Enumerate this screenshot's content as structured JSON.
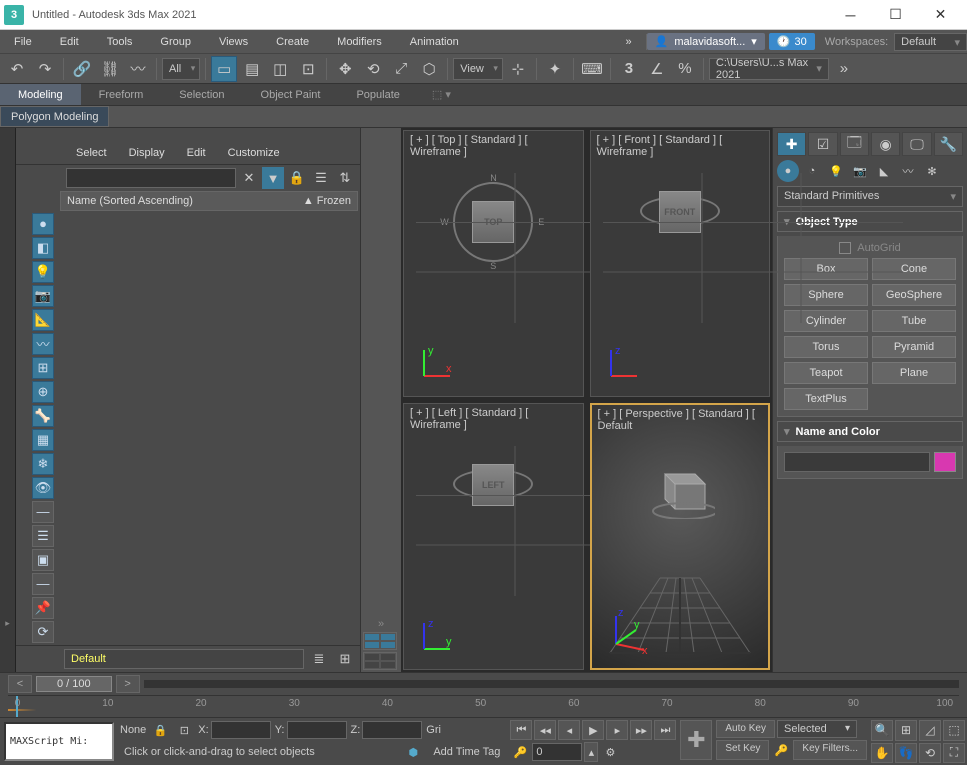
{
  "titlebar": {
    "title": "Untitled - Autodesk 3ds Max 2021"
  },
  "menubar": {
    "items": [
      "File",
      "Edit",
      "Tools",
      "Group",
      "Views",
      "Create",
      "Modifiers",
      "Animation"
    ],
    "user": "malavidasoft...",
    "clock": "30",
    "workspaces_label": "Workspaces:",
    "workspace": "Default"
  },
  "toolbar": {
    "selection_set": "All",
    "view_label": "View",
    "path": "C:\\Users\\U...s Max 2021"
  },
  "ribbon": {
    "tabs": [
      "Modeling",
      "Freeform",
      "Selection",
      "Object Paint",
      "Populate"
    ],
    "subtab": "Polygon Modeling"
  },
  "explorer": {
    "menus": [
      "Select",
      "Display",
      "Edit",
      "Customize"
    ],
    "header_name": "Name (Sorted Ascending)",
    "header_frozen": "▲ Frozen",
    "layer": "Default"
  },
  "viewports": {
    "v0": "[ + ] [ Top ] [ Standard ] [ Wireframe ]",
    "v1": "[ + ] [ Front ] [ Standard ] [ Wireframe ]",
    "v2": "[ + ] [ Left ] [ Standard ] [ Wireframe ]",
    "v3": "[ + ] [ Perspective ] [ Standard ] [ Default",
    "cube0": "TOP",
    "cube1": "FRONT",
    "cube2": "LEFT",
    "compass": {
      "n": "N",
      "s": "S",
      "e": "E",
      "w": "W"
    }
  },
  "cmdpanel": {
    "category": "Standard Primitives",
    "rollout_objtype": "Object Type",
    "autogrid": "AutoGrid",
    "buttons": [
      "Box",
      "Cone",
      "Sphere",
      "GeoSphere",
      "Cylinder",
      "Tube",
      "Torus",
      "Pyramid",
      "Teapot",
      "Plane",
      "TextPlus"
    ],
    "rollout_name": "Name and Color"
  },
  "timeline": {
    "frame": "0 / 100",
    "ticks": [
      "0",
      "10",
      "20",
      "30",
      "40",
      "50",
      "60",
      "70",
      "80",
      "90",
      "100"
    ]
  },
  "status": {
    "maxscript": "MAXScript Mi:",
    "none": "None",
    "x": "X:",
    "y": "Y:",
    "z": "Z:",
    "grid": "Gri",
    "prompt": "Click or click-and-drag to select objects",
    "addtag": "Add Time Tag",
    "spinner": "0",
    "autokey": "Auto Key",
    "setkey": "Set Key",
    "selected": "Selected",
    "keyfilters": "Key Filters..."
  }
}
